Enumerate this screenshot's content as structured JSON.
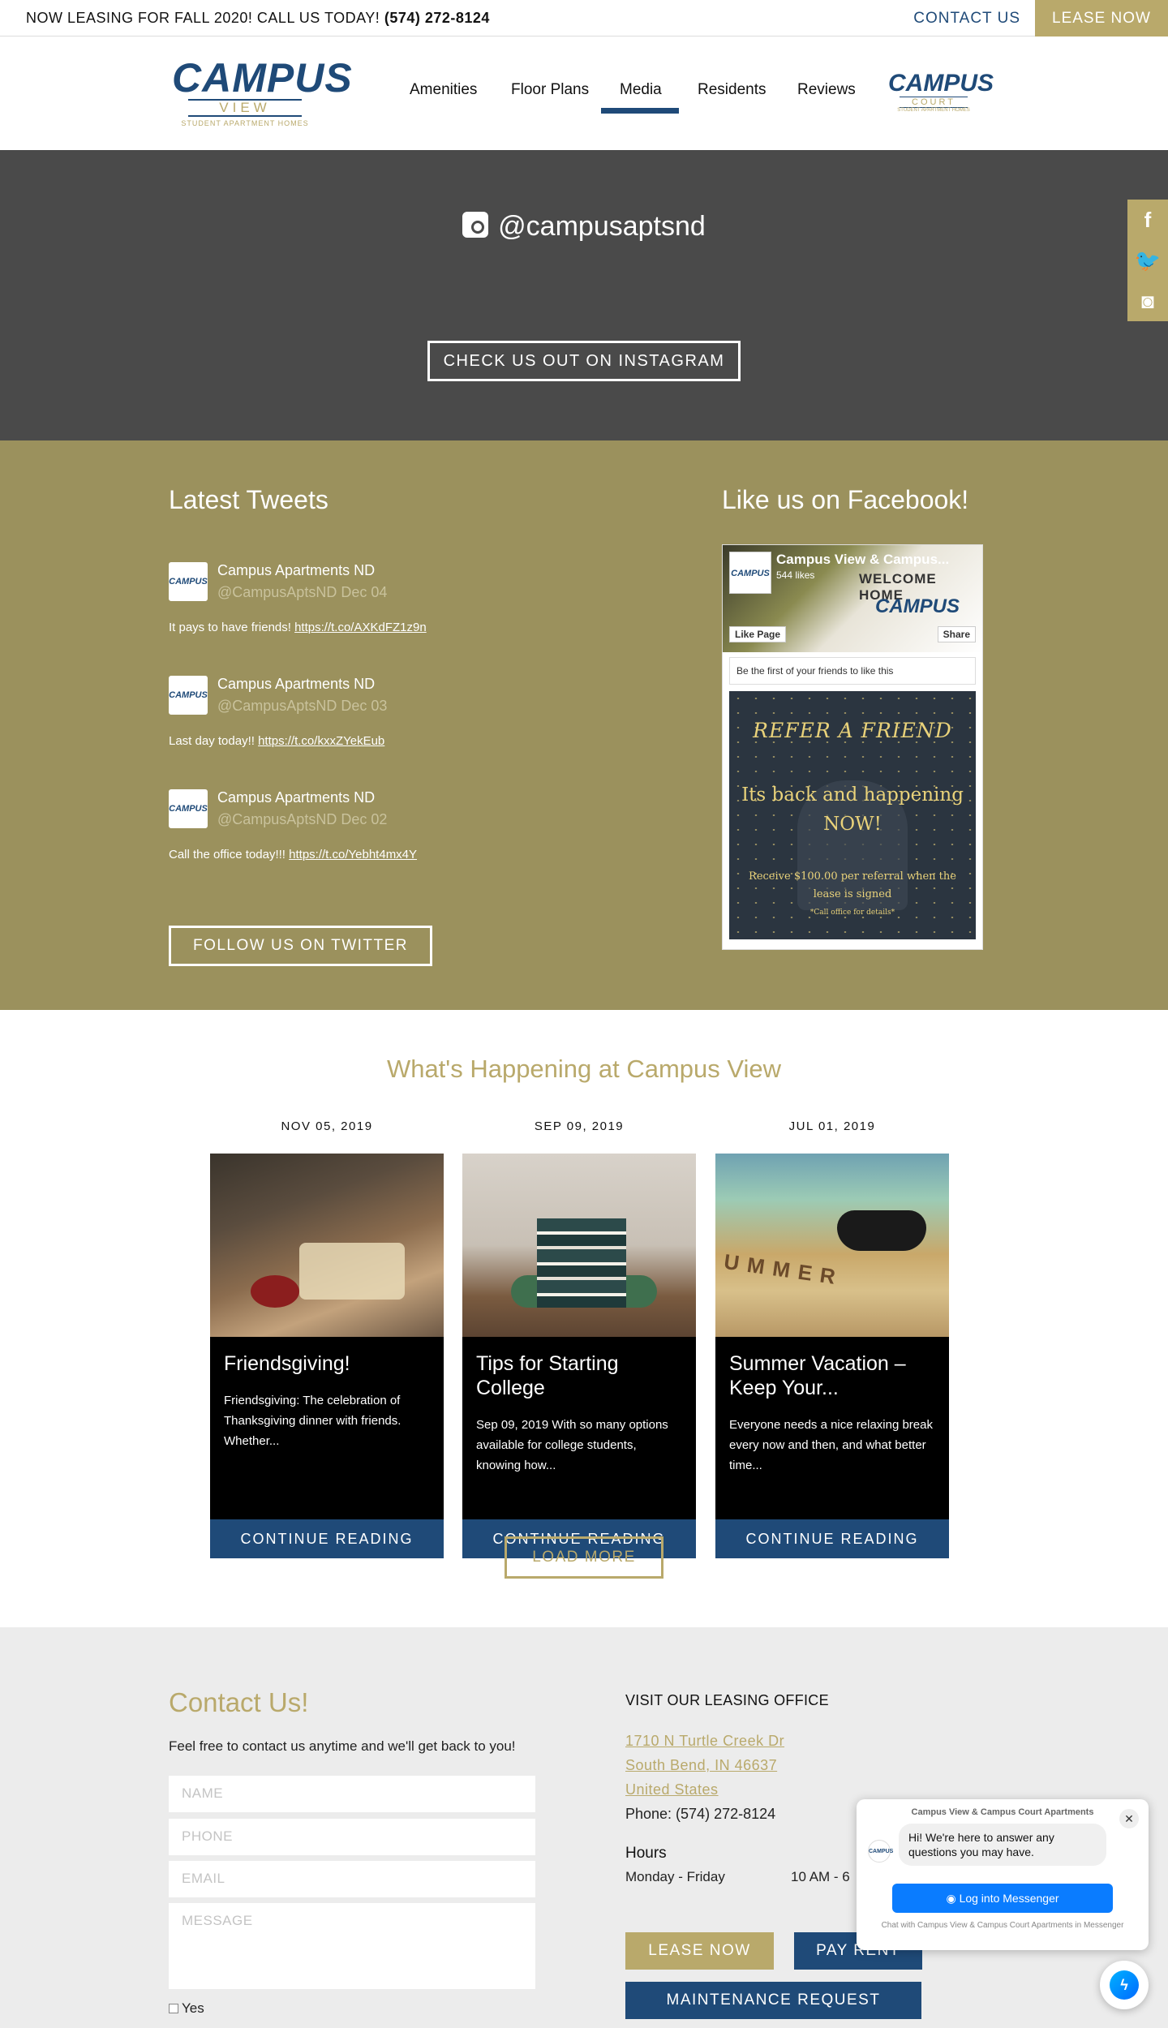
{
  "topbar": {
    "announce": "NOW LEASING FOR FALL 2020! CALL US TODAY!",
    "announce_phone": "(574) 272-8124",
    "contact_label": "CONTACT US",
    "lease_label": "LEASE NOW"
  },
  "header": {
    "logo_main": {
      "word1": "CAMPUS",
      "word2": "VIEW",
      "tagline": "STUDENT APARTMENT HOMES"
    },
    "logo_court": {
      "word1": "CAMPUS",
      "word2": "COURT",
      "tagline": "STUDENT APARTMENT HOMES"
    },
    "nav": [
      "Amenities",
      "Floor Plans",
      "Media",
      "Residents",
      "Reviews"
    ],
    "active_nav": "Media"
  },
  "instagram": {
    "handle": "@campusaptsnd",
    "button": "CHECK US OUT ON INSTAGRAM"
  },
  "side_social": {
    "icons": [
      "facebook-icon",
      "twitter-icon",
      "instagram-icon"
    ],
    "glyphs": [
      "f",
      "🐦",
      "◙"
    ]
  },
  "tweets": {
    "title": "Latest Tweets",
    "items": [
      {
        "name": "Campus Apartments ND",
        "handle": "@CampusAptsND Dec 04",
        "text": "It pays to have friends!",
        "link": "https://t.co/AXKdFZ1z9n"
      },
      {
        "name": "Campus Apartments ND",
        "handle": "@CampusAptsND Dec 03",
        "text": "Last day today!!",
        "link": "https://t.co/kxxZYekEub"
      },
      {
        "name": "Campus Apartments ND",
        "handle": "@CampusAptsND Dec 02",
        "text": "Call the office today!!!",
        "link": "https://t.co/Yebht4mx4Y"
      }
    ],
    "avatar_text": "CAMPUS",
    "follow": "FOLLOW US ON TWITTER"
  },
  "facebook": {
    "title": "Like us on Facebook!",
    "page_name": "Campus View & Campus...",
    "likes": "544 likes",
    "cover_text": "WELCOME HOME",
    "cover_logo": "CAMPUS",
    "like_button": "Like Page",
    "share_button": "Share",
    "friends": "Be the first of your friends to like this",
    "post": {
      "headline": "REFER A FRIEND",
      "line1": "Its back and happening",
      "line2": "NOW!",
      "body": "Receive $100.00 per referral when the lease is signed",
      "note": "*Call office for details*"
    }
  },
  "happenings": {
    "title": "What's Happening at Campus View",
    "posts": [
      {
        "date": "NOV 05, 2019",
        "title": "Friendsgiving!",
        "excerpt": "Friendsgiving: The celebration of Thanksgiving dinner with friends. Whether...",
        "cta": "CONTINUE READING"
      },
      {
        "date": "SEP 09, 2019",
        "title": "Tips for Starting College",
        "excerpt": "Sep 09, 2019 With so many options available for college students, knowing how...",
        "cta": "CONTINUE READING"
      },
      {
        "date": "JUL 01, 2019",
        "title": "Summer Vacation – Keep Your...",
        "excerpt": "Everyone needs a nice relaxing break every now and then, and what better time...",
        "cta": "CONTINUE READING"
      }
    ],
    "summer_tiles": "UMMER",
    "load_more": "LOAD MORE"
  },
  "contact": {
    "title": "Contact Us!",
    "intro": "Feel free to contact us anytime and we'll get back to you!",
    "placeholders": {
      "name": "NAME",
      "phone": "PHONE",
      "email": "EMAIL",
      "message": "MESSAGE"
    },
    "checkbox_label": "Yes",
    "office_heading": "VISIT OUR LEASING OFFICE",
    "address": [
      "1710 N Turtle Creek Dr",
      "South Bend, IN 46637",
      "United States"
    ],
    "phone": "Phone: (574) 272-8124",
    "hours_heading": "Hours",
    "hours_days": "Monday - Friday",
    "hours_time": "10 AM - 6",
    "buttons": {
      "lease": "LEASE NOW",
      "pay": "PAY RENT",
      "maintenance": "MAINTENANCE REQUEST"
    }
  },
  "messenger": {
    "title": "Campus View & Campus Court Apartments",
    "greeting": "Hi! We're here to answer any questions you may have.",
    "login": "Log into Messenger",
    "footer": "Chat with Campus View & Campus Court Apartments in Messenger",
    "avatar_text": "CAMPUS",
    "close_glyph": "✕"
  },
  "colors": {
    "gold": "#b9a96b",
    "navy": "#1f4a78",
    "olive": "#9b915d",
    "dark": "#4a4a4a",
    "messenger_blue": "#0a7cff"
  }
}
